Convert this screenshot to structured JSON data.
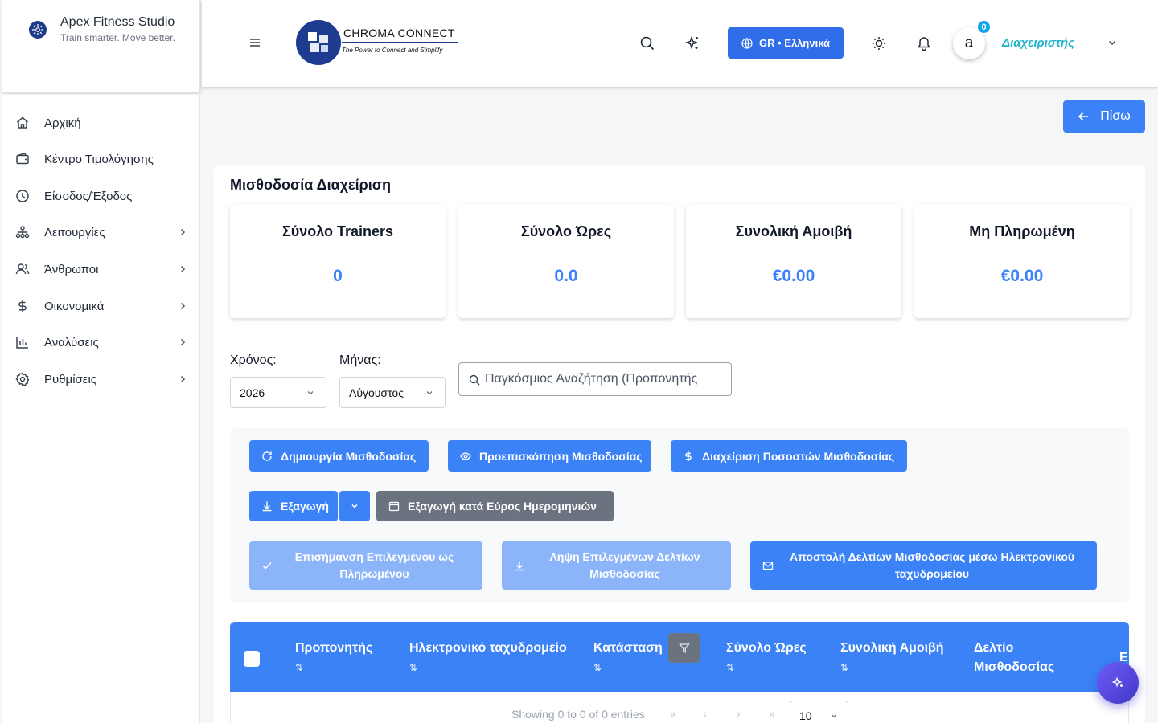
{
  "brand": {
    "name": "Apex Fitness Studio",
    "tagline": "Train smarter. Move better."
  },
  "sidebar": {
    "items": [
      {
        "label": "Αρχική",
        "icon": "home-icon"
      },
      {
        "label": "Κέντρο Τιμολόγησης",
        "icon": "wallet-icon"
      },
      {
        "label": "Είσοδος/Έξοδος",
        "icon": "clock-icon"
      },
      {
        "label": "Λειτουργίες",
        "icon": "sitemap-icon",
        "has_submenu": true
      },
      {
        "label": "Άνθρωποι",
        "icon": "users-icon",
        "has_submenu": true
      },
      {
        "label": "Οικονομικά",
        "icon": "dollar-icon",
        "has_submenu": true
      },
      {
        "label": "Αναλύσεις",
        "icon": "bar-chart-icon",
        "has_submenu": true
      },
      {
        "label": "Ρυθμίσεις",
        "icon": "gear-icon",
        "has_submenu": true
      }
    ]
  },
  "header": {
    "logo_name": "CHROMA CONNECT",
    "logo_tagline": "The Power to Connect and Simplify",
    "language": "GR • Ελληνικά",
    "avatar_letter": "a",
    "notification_count": "0",
    "user_name": "Διαχειριστής"
  },
  "main": {
    "back_label": "Πίσω",
    "title": "Μισθοδοσία Διαχείριση",
    "stats": [
      {
        "label": "Σύνολο Trainers",
        "value": "0"
      },
      {
        "label": "Σύνολο Ώρες",
        "value": "0.0"
      },
      {
        "label": "Συνολική Αμοιβή",
        "value": "€0.00"
      },
      {
        "label": "Μη Πληρωμένη",
        "value": "€0.00"
      }
    ],
    "filters": {
      "year_label": "Χρόνος:",
      "year_value": "2026",
      "month_label": "Μήνας:",
      "month_value": "Αύγουστος",
      "search_placeholder": "Παγκόσμιος Αναζήτηση (Προπονητής"
    },
    "actions": {
      "create": "Δημιουργία Μισθοδοσίας",
      "preview": "Προεπισκόπηση Μισθοδοσίας",
      "manage_rates": "Διαχείριση Ποσοστών Μισθοδοσίας",
      "export": "Εξαγωγή",
      "export_range": "Εξαγωγή κατά Εύρος Ημερομηνιών",
      "mark_paid": "Επισήμανση Επιλεγμένου ως Πληρωμένου",
      "download_slips": "Λήψη Επιλεγμένων Δελτίων Μισθοδοσίας",
      "email_slips": "Αποστολή Δελτίων Μισθοδοσίας μέσω Ηλεκτρονικού ταχυδρομείου"
    },
    "table": {
      "columns": [
        "Προπονητής",
        "Ηλεκτρονικό ταχυδρομείο",
        "Κατάσταση",
        "Σύνολο Ώρες",
        "Συνολική Αμοιβή",
        "Δελτίο Μισθοδοσίας",
        "Ε"
      ],
      "sort_glyph": "⇅",
      "showing": "Showing 0 to 0 of 0 entries",
      "page_size": "10",
      "pager": [
        "«",
        "‹",
        "›",
        "»"
      ]
    }
  },
  "colors": {
    "primary": "#3b82f6",
    "gray_button": "#6b7280",
    "accent_name": "#22b2c9",
    "badge": "#0ea5e9"
  }
}
